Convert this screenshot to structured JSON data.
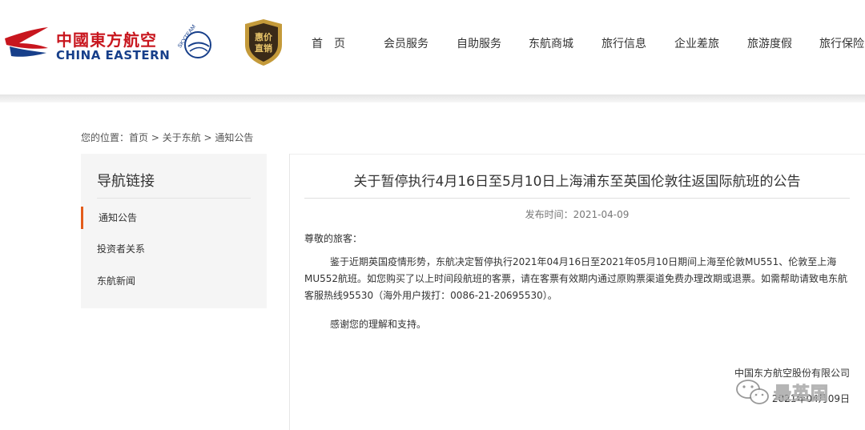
{
  "brand": {
    "name_cn": "中國東方航空",
    "name_en": "CHINA EASTERN",
    "skyteam": "SKYTEAM",
    "badge_line1": "惠价",
    "badge_line2": "直销",
    "colors": {
      "red": "#c8161e",
      "blue": "#173f8a",
      "gold": "#c49a3a",
      "accent": "#e35c1b"
    }
  },
  "nav": {
    "items": [
      {
        "label": "首　页"
      },
      {
        "label": "会员服务"
      },
      {
        "label": "自助服务"
      },
      {
        "label": "东航商城"
      },
      {
        "label": "旅行信息"
      },
      {
        "label": "企业差旅"
      },
      {
        "label": "旅游度假"
      },
      {
        "label": "旅行保险"
      }
    ]
  },
  "breadcrumb": {
    "prefix": "您的位置：",
    "items": [
      "首页",
      "关于东航",
      "通知公告"
    ],
    "separator": " > "
  },
  "sidebar": {
    "title": "导航链接",
    "items": [
      {
        "label": "通知公告",
        "active": true
      },
      {
        "label": "投资者关系",
        "active": false
      },
      {
        "label": "东航新闻",
        "active": false
      }
    ]
  },
  "article": {
    "title": "关于暂停执行4月16日至5月10日上海浦东至英国伦敦往返国际航班的公告",
    "date_label": "发布时间：",
    "date": "2021-04-09",
    "greeting": "尊敬的旅客：",
    "body": "鉴于近期英国疫情形势，东航决定暂停执行2021年04月16日至2021年05月10日期间上海至伦敦MU551、伦敦至上海MU552航班。如您购买了以上时间段航班的客票，请在客票有效期内通过原购票渠道免费办理改期或退票。如需帮助请致电东航客服热线95530（海外用户拨打：0086-21-20695530）。",
    "thanks": "感谢您的理解和支持。",
    "signature": "中国东方航空股份有限公司",
    "sign_date": "2021年04月09日"
  },
  "watermark": {
    "icon": "wechat-icon",
    "text": "最英国"
  }
}
